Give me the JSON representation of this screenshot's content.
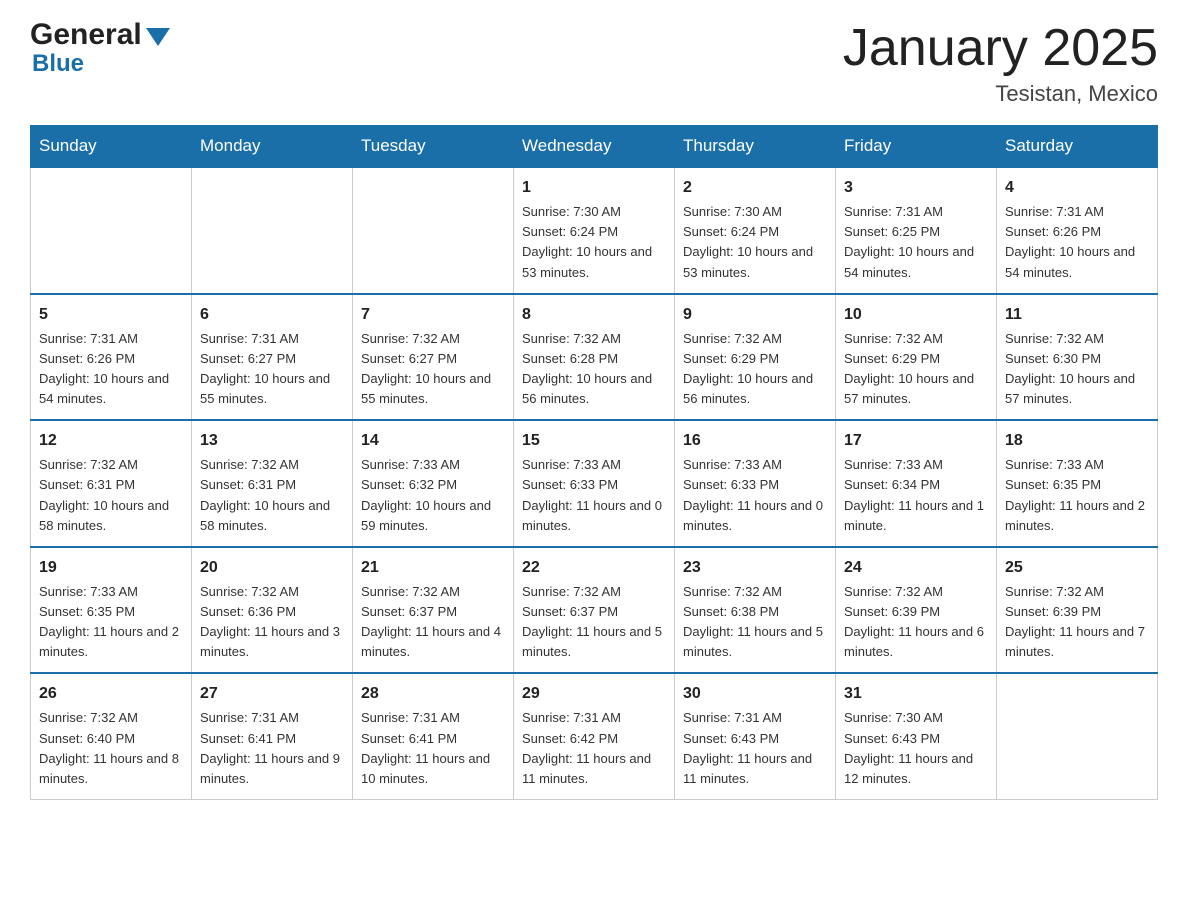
{
  "header": {
    "logo_general": "General",
    "logo_blue": "Blue",
    "month_title": "January 2025",
    "location": "Tesistan, Mexico"
  },
  "days_of_week": [
    "Sunday",
    "Monday",
    "Tuesday",
    "Wednesday",
    "Thursday",
    "Friday",
    "Saturday"
  ],
  "weeks": [
    [
      {
        "day": "",
        "info": ""
      },
      {
        "day": "",
        "info": ""
      },
      {
        "day": "",
        "info": ""
      },
      {
        "day": "1",
        "info": "Sunrise: 7:30 AM\nSunset: 6:24 PM\nDaylight: 10 hours and 53 minutes."
      },
      {
        "day": "2",
        "info": "Sunrise: 7:30 AM\nSunset: 6:24 PM\nDaylight: 10 hours and 53 minutes."
      },
      {
        "day": "3",
        "info": "Sunrise: 7:31 AM\nSunset: 6:25 PM\nDaylight: 10 hours and 54 minutes."
      },
      {
        "day": "4",
        "info": "Sunrise: 7:31 AM\nSunset: 6:26 PM\nDaylight: 10 hours and 54 minutes."
      }
    ],
    [
      {
        "day": "5",
        "info": "Sunrise: 7:31 AM\nSunset: 6:26 PM\nDaylight: 10 hours and 54 minutes."
      },
      {
        "day": "6",
        "info": "Sunrise: 7:31 AM\nSunset: 6:27 PM\nDaylight: 10 hours and 55 minutes."
      },
      {
        "day": "7",
        "info": "Sunrise: 7:32 AM\nSunset: 6:27 PM\nDaylight: 10 hours and 55 minutes."
      },
      {
        "day": "8",
        "info": "Sunrise: 7:32 AM\nSunset: 6:28 PM\nDaylight: 10 hours and 56 minutes."
      },
      {
        "day": "9",
        "info": "Sunrise: 7:32 AM\nSunset: 6:29 PM\nDaylight: 10 hours and 56 minutes."
      },
      {
        "day": "10",
        "info": "Sunrise: 7:32 AM\nSunset: 6:29 PM\nDaylight: 10 hours and 57 minutes."
      },
      {
        "day": "11",
        "info": "Sunrise: 7:32 AM\nSunset: 6:30 PM\nDaylight: 10 hours and 57 minutes."
      }
    ],
    [
      {
        "day": "12",
        "info": "Sunrise: 7:32 AM\nSunset: 6:31 PM\nDaylight: 10 hours and 58 minutes."
      },
      {
        "day": "13",
        "info": "Sunrise: 7:32 AM\nSunset: 6:31 PM\nDaylight: 10 hours and 58 minutes."
      },
      {
        "day": "14",
        "info": "Sunrise: 7:33 AM\nSunset: 6:32 PM\nDaylight: 10 hours and 59 minutes."
      },
      {
        "day": "15",
        "info": "Sunrise: 7:33 AM\nSunset: 6:33 PM\nDaylight: 11 hours and 0 minutes."
      },
      {
        "day": "16",
        "info": "Sunrise: 7:33 AM\nSunset: 6:33 PM\nDaylight: 11 hours and 0 minutes."
      },
      {
        "day": "17",
        "info": "Sunrise: 7:33 AM\nSunset: 6:34 PM\nDaylight: 11 hours and 1 minute."
      },
      {
        "day": "18",
        "info": "Sunrise: 7:33 AM\nSunset: 6:35 PM\nDaylight: 11 hours and 2 minutes."
      }
    ],
    [
      {
        "day": "19",
        "info": "Sunrise: 7:33 AM\nSunset: 6:35 PM\nDaylight: 11 hours and 2 minutes."
      },
      {
        "day": "20",
        "info": "Sunrise: 7:32 AM\nSunset: 6:36 PM\nDaylight: 11 hours and 3 minutes."
      },
      {
        "day": "21",
        "info": "Sunrise: 7:32 AM\nSunset: 6:37 PM\nDaylight: 11 hours and 4 minutes."
      },
      {
        "day": "22",
        "info": "Sunrise: 7:32 AM\nSunset: 6:37 PM\nDaylight: 11 hours and 5 minutes."
      },
      {
        "day": "23",
        "info": "Sunrise: 7:32 AM\nSunset: 6:38 PM\nDaylight: 11 hours and 5 minutes."
      },
      {
        "day": "24",
        "info": "Sunrise: 7:32 AM\nSunset: 6:39 PM\nDaylight: 11 hours and 6 minutes."
      },
      {
        "day": "25",
        "info": "Sunrise: 7:32 AM\nSunset: 6:39 PM\nDaylight: 11 hours and 7 minutes."
      }
    ],
    [
      {
        "day": "26",
        "info": "Sunrise: 7:32 AM\nSunset: 6:40 PM\nDaylight: 11 hours and 8 minutes."
      },
      {
        "day": "27",
        "info": "Sunrise: 7:31 AM\nSunset: 6:41 PM\nDaylight: 11 hours and 9 minutes."
      },
      {
        "day": "28",
        "info": "Sunrise: 7:31 AM\nSunset: 6:41 PM\nDaylight: 11 hours and 10 minutes."
      },
      {
        "day": "29",
        "info": "Sunrise: 7:31 AM\nSunset: 6:42 PM\nDaylight: 11 hours and 11 minutes."
      },
      {
        "day": "30",
        "info": "Sunrise: 7:31 AM\nSunset: 6:43 PM\nDaylight: 11 hours and 11 minutes."
      },
      {
        "day": "31",
        "info": "Sunrise: 7:30 AM\nSunset: 6:43 PM\nDaylight: 11 hours and 12 minutes."
      },
      {
        "day": "",
        "info": ""
      }
    ]
  ]
}
